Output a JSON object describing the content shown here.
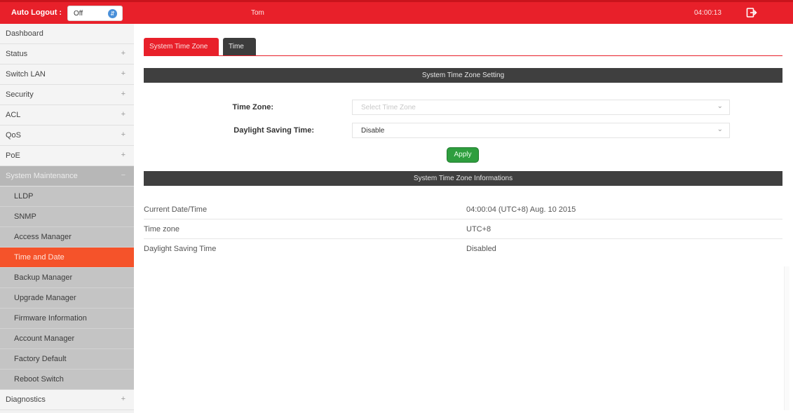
{
  "topbar": {
    "auto_logout_label": "Auto Logout :",
    "auto_logout_value": "Off",
    "user": "Tom",
    "clock": "04:00:13",
    "logout_icon": "logout-icon"
  },
  "sidebar": {
    "items": [
      {
        "label": "Dashboard",
        "sign": ""
      },
      {
        "label": "Status",
        "sign": "+"
      },
      {
        "label": "Switch LAN",
        "sign": "+"
      },
      {
        "label": "Security",
        "sign": "+"
      },
      {
        "label": "ACL",
        "sign": "+"
      },
      {
        "label": "QoS",
        "sign": "+"
      },
      {
        "label": "PoE",
        "sign": "+"
      },
      {
        "label": "System Maintenance",
        "sign": "−"
      },
      {
        "label": "LLDP"
      },
      {
        "label": "SNMP"
      },
      {
        "label": "Access Manager"
      },
      {
        "label": "Time and Date"
      },
      {
        "label": "Backup Manager"
      },
      {
        "label": "Upgrade Manager"
      },
      {
        "label": "Firmware Information"
      },
      {
        "label": "Account Manager"
      },
      {
        "label": "Factory Default"
      },
      {
        "label": "Reboot Switch"
      },
      {
        "label": "Diagnostics",
        "sign": "+"
      }
    ]
  },
  "tabs": [
    "System Time Zone",
    "Time"
  ],
  "setting": {
    "title": "System Time Zone Setting",
    "time_zone_label": "Time Zone:",
    "time_zone_placeholder": "Select Time Zone",
    "dst_label": "Daylight Saving Time:",
    "dst_value": "Disable",
    "apply_label": "Apply"
  },
  "info": {
    "title": "System Time Zone Informations",
    "rows": [
      {
        "key": "Current Date/Time",
        "value": "04:00:04 (UTC+8) Aug. 10 2015"
      },
      {
        "key": "Time zone",
        "value": "UTC+8"
      },
      {
        "key": "Daylight Saving Time",
        "value": "Disabled"
      }
    ]
  },
  "colors": {
    "brand_red": "#e8202a",
    "active_orange": "#f5532a",
    "apply_green": "#2e9e3e",
    "section_dark": "#3f3f3f"
  }
}
